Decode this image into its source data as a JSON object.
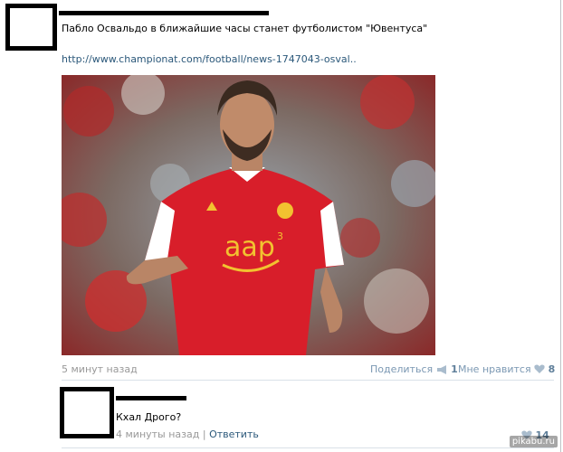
{
  "post": {
    "text": "Пабло Освальдо в ближайшие часы станет футболистом \"Ювентуса\"",
    "link": "http://www.championat.com/football/news-1747043-osval..",
    "time": "5 минут назад",
    "share_label": "Поделиться",
    "share_count": "1",
    "like_label": "Мне нравится",
    "like_count": "8",
    "photo": {
      "jersey_color": "#d81e2a",
      "sponsor_text": "aap",
      "sponsor_sup": "3"
    }
  },
  "comment": {
    "text": "Кхал Дрого?",
    "time": "4 минуты назад",
    "reply_label": "Ответить",
    "like_count": "14"
  },
  "watermark": "pikabu.ru",
  "colors": {
    "link": "#2b587a",
    "meta_grey": "#999999",
    "separator": "#dae1e8"
  }
}
